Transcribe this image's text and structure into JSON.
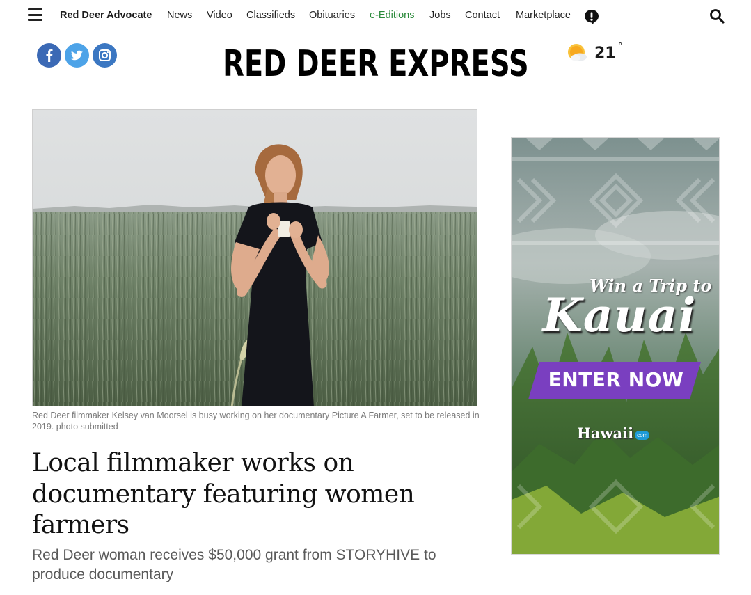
{
  "nav": {
    "brand": "Red Deer Advocate",
    "links": [
      "News",
      "Video",
      "Classifieds",
      "Obituaries",
      "e-Editions",
      "Jobs",
      "Contact",
      "Marketplace"
    ]
  },
  "icons": {
    "menu": "hamburger-menu-icon",
    "alert": "alert-icon",
    "search": "search-icon",
    "facebook": "facebook-icon",
    "twitter": "twitter-icon",
    "instagram": "instagram-icon",
    "weather": "partly-sunny-icon"
  },
  "header": {
    "masthead": "RED DEER EXPRESS",
    "temperature": "21",
    "degree": "°"
  },
  "colors": {
    "accent_link": "#2a8a3a",
    "social_blue": "#3b77c2",
    "twitter_blue": "#4da3e8",
    "ad_purple": "#7a3fc0"
  },
  "article": {
    "caption": "Red Deer filmmaker Kelsey van Moorsel is busy working on her documentary Picture A Farmer, set to be released in 2019. photo submitted",
    "headline": "Local filmmaker works on documentary featuring women farmers",
    "subhead": "Red Deer woman receives $50,000 grant from STORYHIVE to produce documentary"
  },
  "ad": {
    "tagline": "Win a Trip to",
    "destination": "Kauai",
    "cta": "ENTER NOW",
    "sponsor": "Hawaii",
    "sponsor_badge": "com"
  }
}
